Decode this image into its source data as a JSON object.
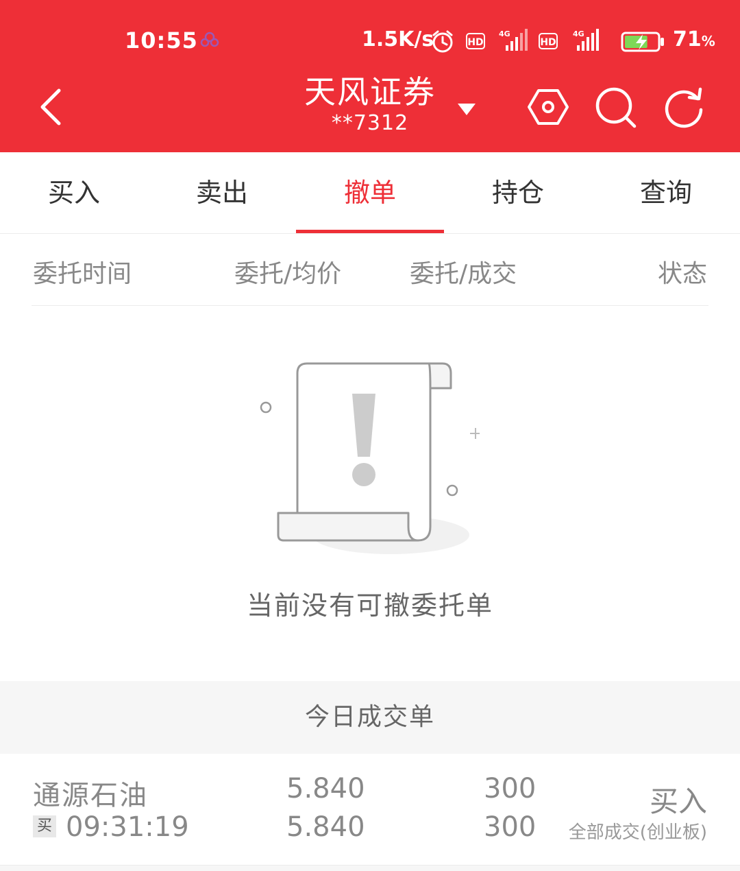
{
  "status_bar": {
    "time": "10:55",
    "net_speed": "1.5K/s",
    "hd_label": "HD",
    "network_type": "4G",
    "battery_percent": "71",
    "battery_unit": "%",
    "battery_level": 0.71
  },
  "nav": {
    "title": "天风证券",
    "account": "**7312"
  },
  "tabs": [
    {
      "label": "买入",
      "active": false
    },
    {
      "label": "卖出",
      "active": false
    },
    {
      "label": "撤单",
      "active": true
    },
    {
      "label": "持仓",
      "active": false
    },
    {
      "label": "查询",
      "active": false
    }
  ],
  "columns": {
    "time": "委托时间",
    "price": "委托/均价",
    "qty": "委托/成交",
    "status": "状态"
  },
  "empty_state": {
    "message": "当前没有可撤委托单"
  },
  "today_trades": {
    "title": "今日成交单",
    "rows": [
      {
        "name": "通源石油",
        "side_badge": "买",
        "time": "09:31:19",
        "order_price": "5.840",
        "avg_price": "5.840",
        "order_qty": "300",
        "filled_qty": "300",
        "action": "买入",
        "status": "全部成交(创业板)"
      }
    ]
  },
  "colors": {
    "brand_red": "#ee2f37",
    "text_gray": "#888888"
  }
}
